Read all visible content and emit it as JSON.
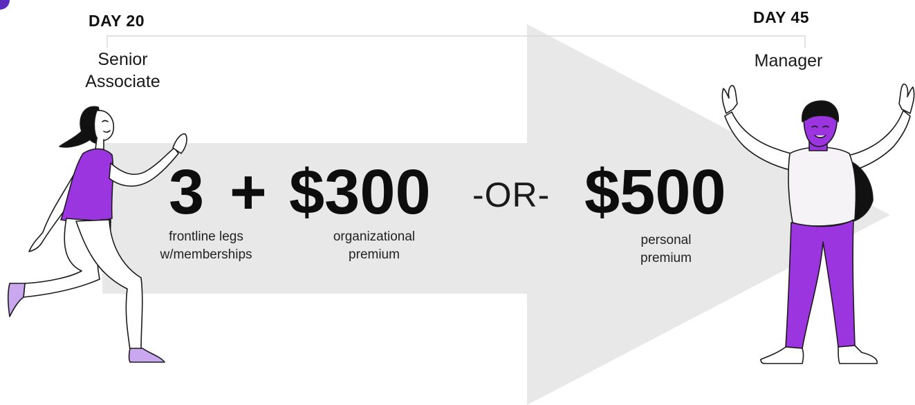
{
  "colors": {
    "arrow": "#e8e8e8",
    "accent": "#9b35e0",
    "connector": "#d9d9d9",
    "corner": "#5b2bbf"
  },
  "left_milestone": {
    "day": "DAY 20",
    "rank_line1": "Senior",
    "rank_line2": "Associate"
  },
  "right_milestone": {
    "day": "DAY 45",
    "rank": "Manager"
  },
  "requirements": {
    "legs_value": "3",
    "plus": "+",
    "legs_caption_line1": "frontline legs",
    "legs_caption_line2": "w/memberships",
    "org_value": "$300",
    "org_caption_line1": "organizational",
    "org_caption_line2": "premium",
    "or_text": "-OR-",
    "personal_value": "$500",
    "personal_caption_line1": "personal",
    "personal_caption_line2": "premium"
  },
  "illustrations": {
    "left": "running-woman-illustration",
    "right": "cheering-man-illustration"
  }
}
